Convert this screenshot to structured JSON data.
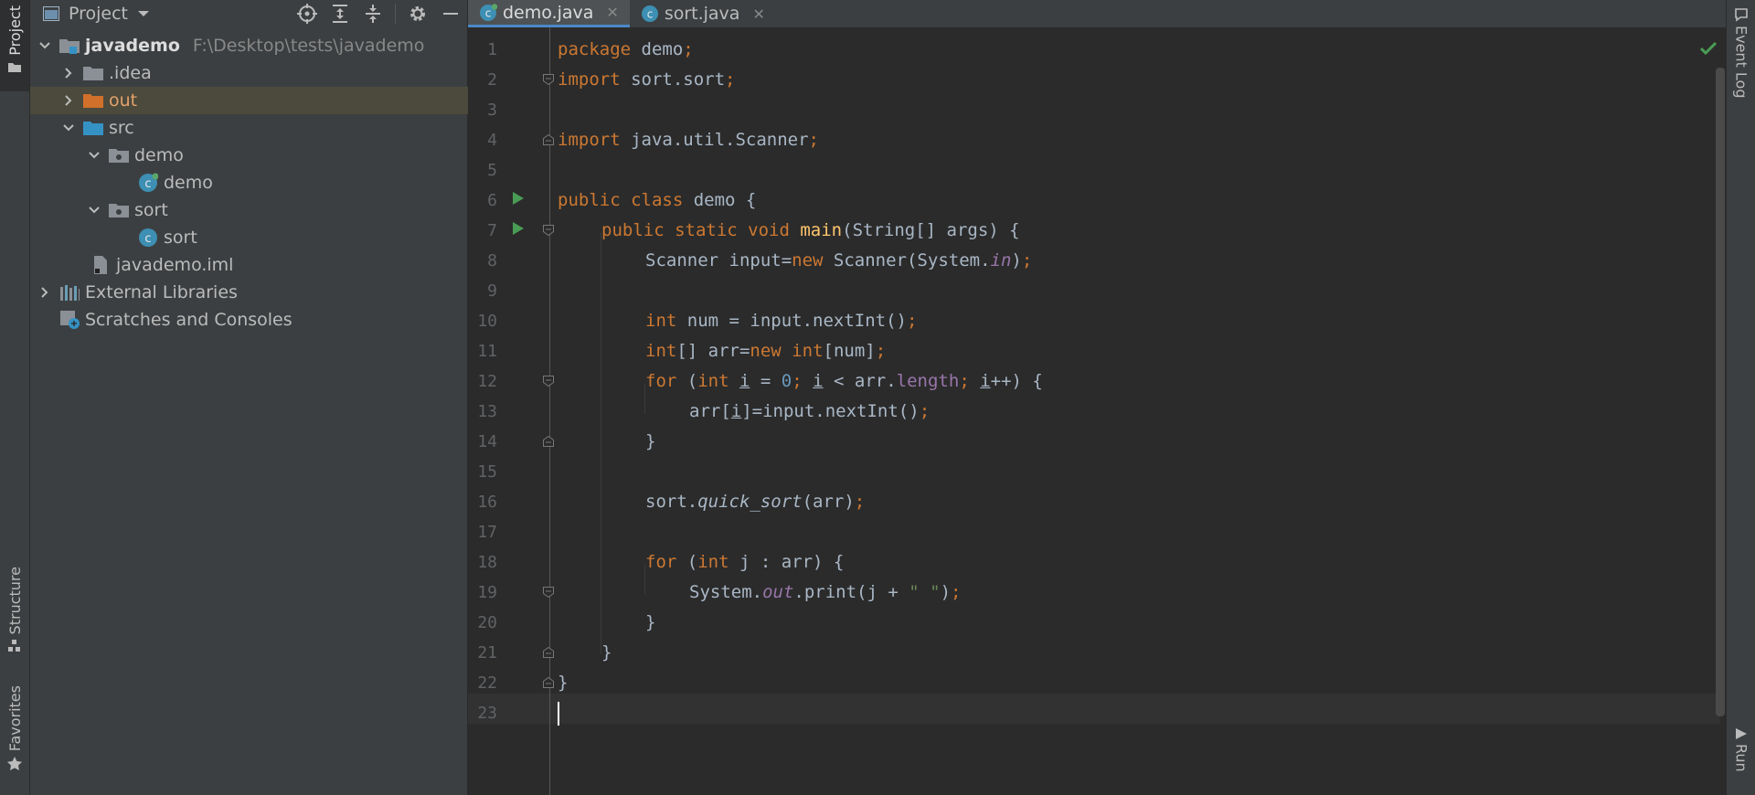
{
  "left_strip": {
    "project_tab": "Project",
    "structure_tab": "Structure",
    "favorites_tab": "Favorites"
  },
  "right_strip": {
    "event_log_tab": "Event Log",
    "run_tab": "Run"
  },
  "project_panel": {
    "title": "Project",
    "tree": [
      {
        "label": "javademo",
        "path": "F:\\Desktop\\tests\\javademo"
      },
      {
        "label": ".idea"
      },
      {
        "label": "out"
      },
      {
        "label": "src"
      },
      {
        "label": "demo"
      },
      {
        "label": "demo"
      },
      {
        "label": "sort"
      },
      {
        "label": "sort"
      },
      {
        "label": "javademo.iml"
      },
      {
        "label": "External Libraries"
      },
      {
        "label": "Scratches and Consoles"
      }
    ]
  },
  "editor": {
    "tabs": [
      {
        "label": "demo.java",
        "active": true
      },
      {
        "label": "sort.java",
        "active": false
      }
    ],
    "line_numbers": [
      "1",
      "2",
      "3",
      "4",
      "5",
      "6",
      "7",
      "8",
      "9",
      "10",
      "11",
      "12",
      "13",
      "14",
      "15",
      "16",
      "17",
      "18",
      "19",
      "20",
      "21",
      "22",
      "23"
    ],
    "current_line": 23,
    "code": {
      "l1_kw": "package",
      "l1_rest": " demo",
      "l1_semi": ";",
      "l2_kw": "import",
      "l2_rest": " sort.sort",
      "l2_semi": ";",
      "l4_kw": "import",
      "l4_rest": " java.util.Scanner",
      "l4_semi": ";",
      "l6_kw": "public class",
      "l6_rest": " demo {",
      "l7_kw": "public static void",
      "l7_fn": "main",
      "l7_rest": "(String[] args) {",
      "l8_a": "Scanner input=",
      "l8_kw": "new",
      "l8_b": " Scanner(System.",
      "l8_fld": "in",
      "l8_c": ")",
      "l8_semi": ";",
      "l10_kw": "int",
      "l10_rest": " num = input.nextInt()",
      "l10_semi": ";",
      "l11_kw1": "int",
      "l11_a": "[] arr=",
      "l11_kw2": "new",
      "l11_kw3": "int",
      "l11_b": "[num]",
      "l11_semi": ";",
      "l12_kw1": "for",
      "l12_a": " (",
      "l12_kw2": "int",
      "l12_var1": "i",
      "l12_b": " = ",
      "l12_num": "0",
      "l12_semi1": ";",
      "l12_var2": "i",
      "l12_c": " < arr.",
      "l12_fld": "length",
      "l12_semi2": ";",
      "l12_var3": "i",
      "l12_d": "++) {",
      "l13_a": "arr[",
      "l13_var": "i",
      "l13_b": "]=input.nextInt()",
      "l13_semi": ";",
      "l14": "}",
      "l16_a": "sort.",
      "l16_fn": "quick_sort",
      "l16_b": "(arr)",
      "l16_semi": ";",
      "l18_kw1": "for",
      "l18_a": " (",
      "l18_kw2": "int",
      "l18_b": " j : arr) {",
      "l19_a": "System.",
      "l19_fld": "out",
      "l19_b": ".print(j + ",
      "l19_str": "\" \"",
      "l19_c": ")",
      "l19_semi": ";",
      "l20": "}",
      "l21": "}",
      "l22": "}"
    }
  },
  "colors": {
    "keyword": "#cc7832",
    "function": "#ffc66d",
    "number": "#6897bb",
    "string": "#6a8759",
    "field": "#9876aa",
    "text": "#a9b7c6"
  }
}
